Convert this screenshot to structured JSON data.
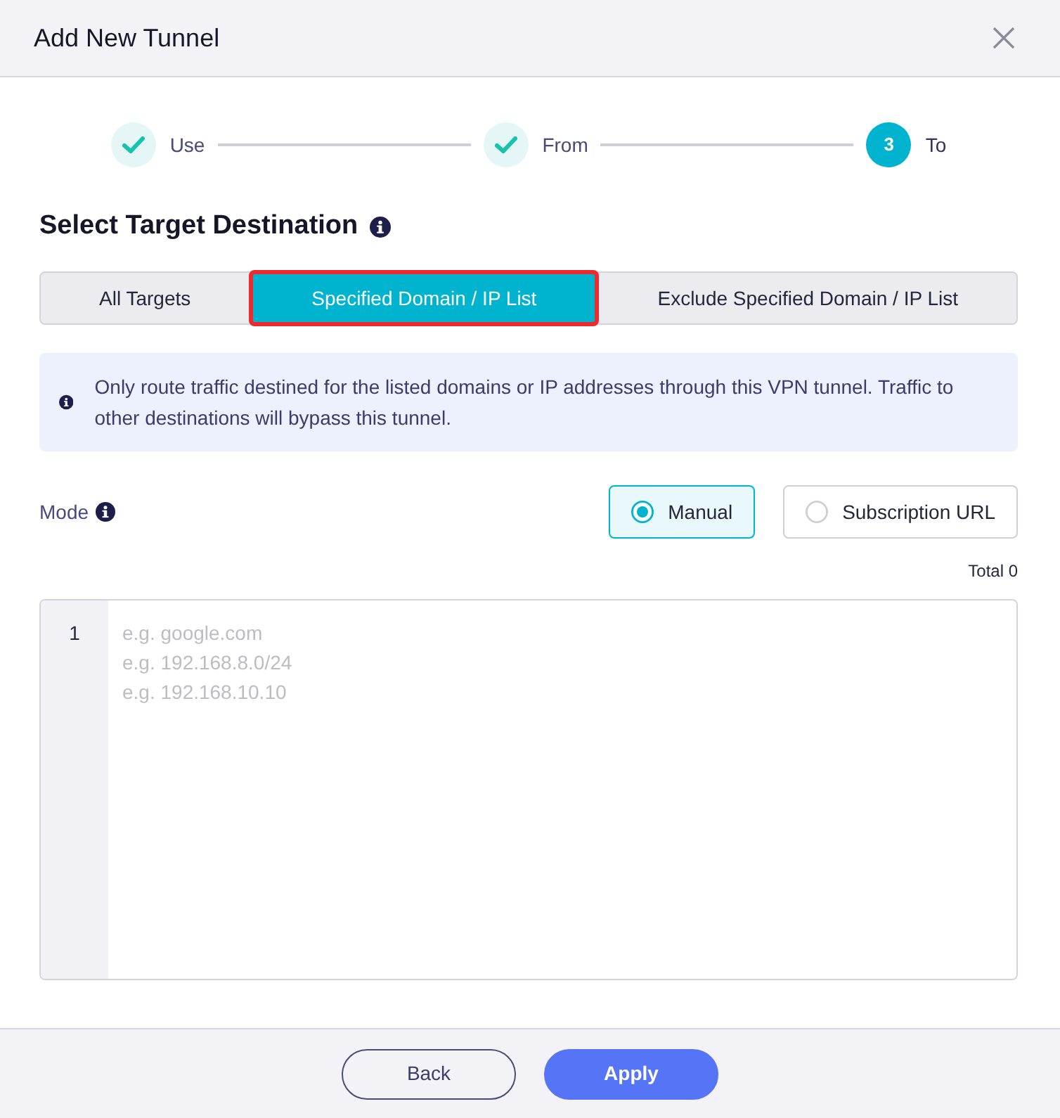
{
  "dialog": {
    "title": "Add New Tunnel"
  },
  "steps": [
    {
      "label": "Use",
      "done": true,
      "current": false
    },
    {
      "label": "From",
      "done": true,
      "current": false
    },
    {
      "label": "To",
      "done": false,
      "current": true,
      "number": "3"
    }
  ],
  "section": {
    "title": "Select Target Destination"
  },
  "target_tabs": [
    {
      "label": "All Targets",
      "selected": false,
      "highlighted": false
    },
    {
      "label": "Specified Domain / IP List",
      "selected": true,
      "highlighted": true
    },
    {
      "label": "Exclude Specified Domain / IP List",
      "selected": false,
      "highlighted": false
    }
  ],
  "notice": {
    "text": "Only route traffic destined for the listed domains or IP addresses through this VPN tunnel. Traffic to other destinations will bypass this tunnel."
  },
  "mode": {
    "label": "Mode",
    "options": [
      {
        "label": "Manual",
        "selected": true
      },
      {
        "label": "Subscription URL",
        "selected": false
      }
    ]
  },
  "list_editor": {
    "total": "Total 0",
    "line_numbers": [
      "1"
    ],
    "placeholder": "e.g. google.com\ne.g. 192.168.8.0/24\ne.g. 192.168.10.10"
  },
  "buttons": [
    {
      "label": "Back",
      "kind": "secondary"
    },
    {
      "label": "Apply",
      "kind": "primary"
    }
  ]
}
